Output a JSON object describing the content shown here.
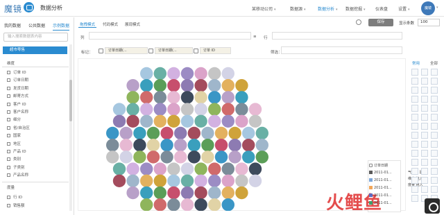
{
  "header": {
    "logo_text": "魔镜",
    "app_title": "数据分析",
    "nav": [
      {
        "label": "某移动公司",
        "caret": "▾"
      },
      {
        "label": "数据源",
        "caret": "▾"
      },
      {
        "label": "数据分析",
        "caret": "▾"
      },
      {
        "label": "数据挖掘",
        "caret": "▾"
      },
      {
        "label": "仪表盘",
        "caret": ""
      },
      {
        "label": "设置",
        "caret": "▾"
      }
    ],
    "active_nav": "数据分析",
    "avatar_text": "魔镜"
  },
  "sidebar": {
    "tabs": [
      "我的数据",
      "公共数据",
      "示例数据"
    ],
    "active_tab": "示例数据",
    "search_placeholder": "输入搜索数据表内容",
    "active_dataset": "超市零售",
    "group1_title": "维度",
    "dimensions": [
      "订单 ID",
      "订单日期",
      "发货日期",
      "邮寄方式",
      "客户 ID",
      "客户名称",
      "细分",
      "省/自治区",
      "国家",
      "地区",
      "产品 ID",
      "类别",
      "子类别",
      "产品名称"
    ],
    "group2_title": "度量",
    "measures": [
      "行 ID",
      "销售额"
    ]
  },
  "center": {
    "tabs": [
      "拖拽模式",
      "代码模式",
      "展现模式"
    ],
    "active_tab": "拖拽模式",
    "col_label": "列",
    "row_label": "行",
    "mark_label": "标记：",
    "chips": [
      "订单日期(...",
      "订单日期(...",
      "订单 ID"
    ],
    "filter_label": "筛选："
  },
  "legend": {
    "title": "订单日期",
    "items": [
      {
        "label": "2011-01...",
        "color": "#5a5a5a"
      },
      {
        "label": "2011-01...",
        "color": "#7ca6d8"
      },
      {
        "label": "2011-01...",
        "color": "#f2a65a"
      },
      {
        "label": "2011-01...",
        "color": "#5c6bc0"
      },
      {
        "label": "2011-01...",
        "color": "#3b9e6e"
      }
    ]
  },
  "side_texts": [
    "气泡图 建议",
    "维度 拖入",
    "度量 拖入"
  ],
  "toolbar": {
    "save_label": "保存",
    "row_count_label": "显示条数",
    "row_count_value": "100"
  },
  "right_panel": {
    "tabs": [
      "常用",
      "全部"
    ],
    "active_tab": "常用"
  },
  "watermark": "火鲤鱼",
  "colors": {
    "accent": "#2a8bd0"
  },
  "chart_data": {
    "type": "bubble",
    "palette": [
      "#a6c7e0",
      "#e7b9d3",
      "#9fb6cb",
      "#8fb55c",
      "#c74f6d",
      "#dba3c9",
      "#b8a0c8",
      "#69b0a5",
      "#3d4a5c",
      "#e3b15f",
      "#d06a6b",
      "#8d7bb2",
      "#c5c5c5",
      "#3a9fbd",
      "#d2b1e1",
      "#e1d3a6",
      "#cfa33a",
      "#7b8c99",
      "#a44c5d",
      "#d3d3e6",
      "#5b9e58",
      "#9c8cc4",
      "#3a96c6"
    ],
    "row_counts": [
      7,
      9,
      9,
      11,
      11,
      12,
      12,
      12,
      11,
      11,
      9,
      7
    ]
  }
}
